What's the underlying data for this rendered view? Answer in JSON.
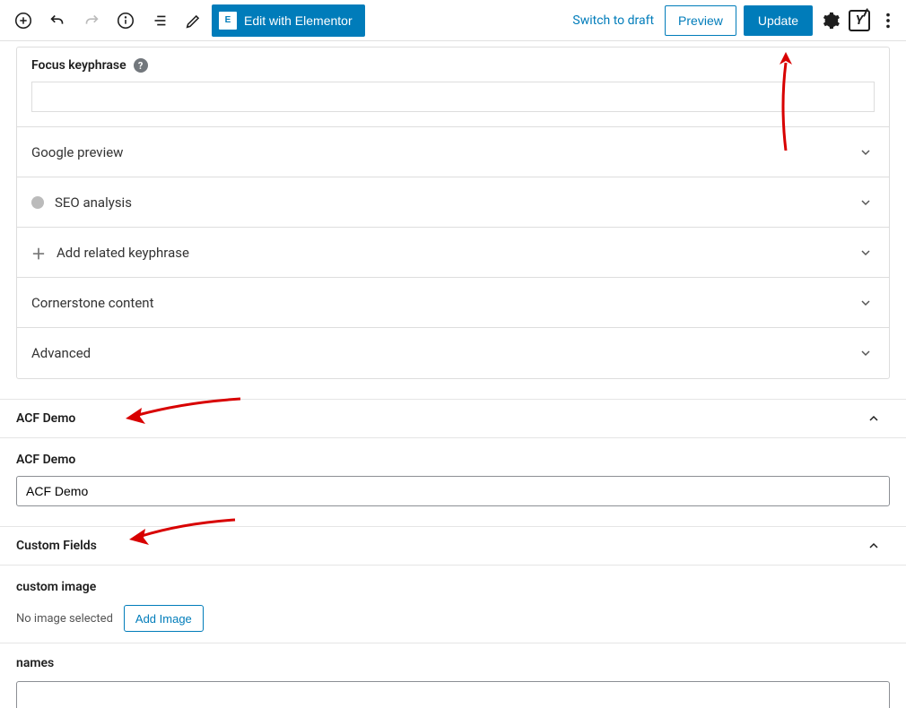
{
  "topbar": {
    "elementor_label": "Edit with Elementor",
    "elementor_icon_text": "E",
    "draft_link": "Switch to draft",
    "preview_label": "Preview",
    "update_label": "Update",
    "yoast_letter": "Y"
  },
  "yoast": {
    "focus_label": "Focus keyphrase",
    "focus_value": "",
    "help": "?",
    "rows": {
      "google_preview": "Google preview",
      "seo_analysis": "SEO analysis",
      "add_related": "Add related keyphrase",
      "cornerstone": "Cornerstone content",
      "advanced": "Advanced"
    }
  },
  "acf": {
    "panel_title": "ACF Demo",
    "field_label": "ACF Demo",
    "field_value": "ACF Demo"
  },
  "custom_fields": {
    "panel_title": "Custom Fields",
    "image_label": "custom image",
    "no_image_text": "No image selected",
    "add_image_label": "Add Image",
    "names_label": "names",
    "names_value": ""
  }
}
